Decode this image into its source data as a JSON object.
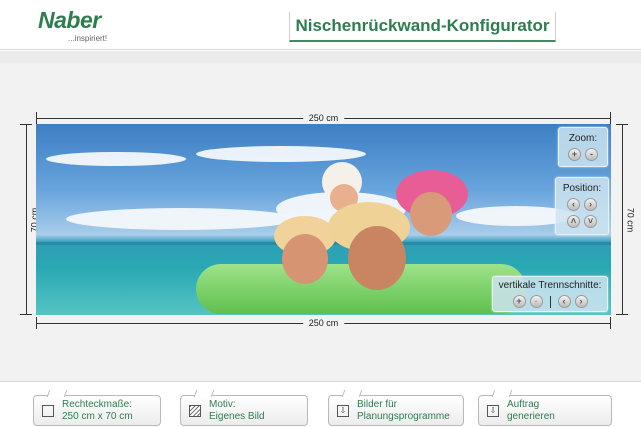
{
  "header": {
    "logo_text": "Naber",
    "logo_slogan": "...inspiriert!",
    "title": "Nischenrückwand-Konfigurator"
  },
  "dimensions": {
    "width_top": "250 cm",
    "width_bottom": "250 cm",
    "height_left": "70 cm",
    "height_right": "70 cm"
  },
  "controls": {
    "zoom_label": "Zoom:",
    "zoom_in": "+",
    "zoom_out": "-",
    "position_label": "Position:",
    "pos_left": "‹",
    "pos_right": "›",
    "pos_up": "˄",
    "pos_down": "˅",
    "cuts_label": "vertikale Trennschnitte:",
    "cuts_add": "+",
    "cuts_remove": "-",
    "cuts_prev": "‹",
    "cuts_next": "›"
  },
  "toolbar": {
    "dimensions_btn": {
      "line1": "Rechteckmaße:",
      "line2": "250 cm x 70 cm"
    },
    "motif_btn": {
      "line1": "Motiv:",
      "line2": "Eigenes Bild"
    },
    "images_btn": {
      "line1": "Bilder für",
      "line2": "Planungsprogramme"
    },
    "order_btn": {
      "line1": "Auftrag",
      "line2": "generieren"
    }
  },
  "icons": {
    "dimensions_btn": "rectangle-icon",
    "motif_btn": "hatch-icon",
    "images_btn": "document-icon",
    "order_btn": "document-icon"
  },
  "colors": {
    "brand_green": "#2e7d4f"
  }
}
